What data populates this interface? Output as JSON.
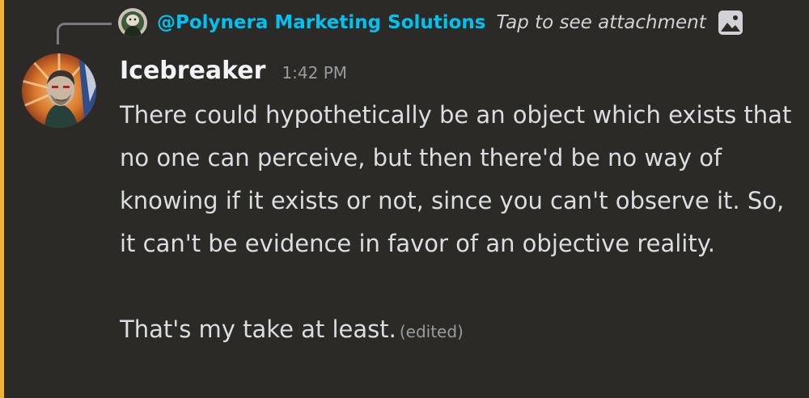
{
  "reply": {
    "author": "@Polynera Marketing Solutions",
    "preview": "Tap to see attachment",
    "attachment_icon": "image-icon"
  },
  "message": {
    "username": "Icebreaker",
    "timestamp": "1:42 PM",
    "paragraph_1": "There could hypothetically be an object which exists that no one can perceive, but then there'd be no way of knowing if it exists or not, since you can't observe it. So, it can't be evidence in favor of an objective reality.",
    "paragraph_2": "That's my take at least.",
    "edited_label": "(edited)"
  },
  "colors": {
    "background": "#2c2a27",
    "accent_bar": "#f0b232",
    "reply_author": "#00c2f0",
    "username": "#f2f3f5",
    "text": "#dcdde1",
    "muted": "#9a9ba1"
  }
}
